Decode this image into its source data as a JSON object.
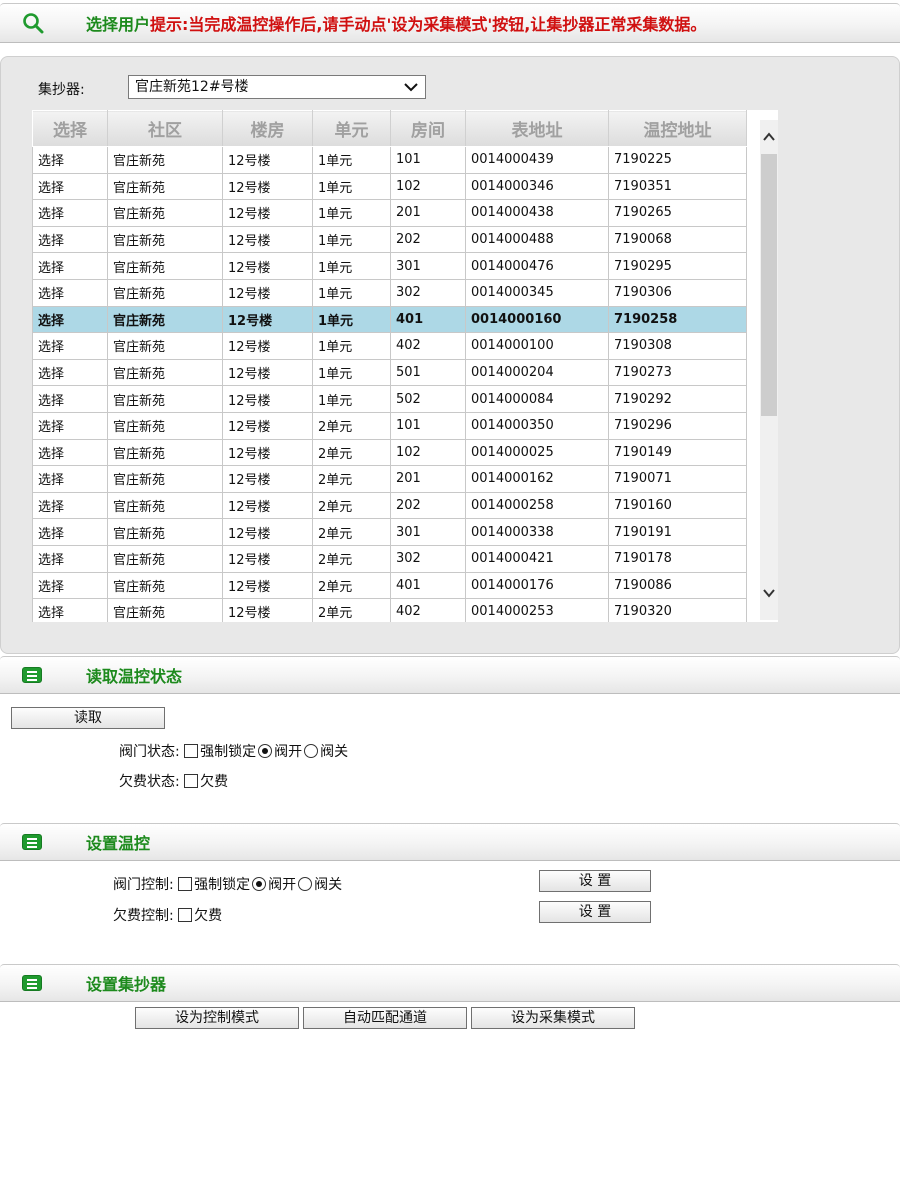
{
  "top_bar": {
    "title": "选择用户",
    "hint": "提示:当完成温控操作后,请手动点'设为采集模式'按钮,让集抄器正常采集数据。"
  },
  "collector": {
    "label": "集抄器:",
    "selected": "官庄新苑12#号楼"
  },
  "table": {
    "columns": [
      "选择",
      "社区",
      "楼房",
      "单元",
      "房间",
      "表地址",
      "温控地址"
    ],
    "selected_index": 6,
    "rows": [
      [
        "选择",
        "官庄新苑",
        "12号楼",
        "1单元",
        "101",
        "0014000439",
        "7190225"
      ],
      [
        "选择",
        "官庄新苑",
        "12号楼",
        "1单元",
        "102",
        "0014000346",
        "7190351"
      ],
      [
        "选择",
        "官庄新苑",
        "12号楼",
        "1单元",
        "201",
        "0014000438",
        "7190265"
      ],
      [
        "选择",
        "官庄新苑",
        "12号楼",
        "1单元",
        "202",
        "0014000488",
        "7190068"
      ],
      [
        "选择",
        "官庄新苑",
        "12号楼",
        "1单元",
        "301",
        "0014000476",
        "7190295"
      ],
      [
        "选择",
        "官庄新苑",
        "12号楼",
        "1单元",
        "302",
        "0014000345",
        "7190306"
      ],
      [
        "选择",
        "官庄新苑",
        "12号楼",
        "1单元",
        "401",
        "0014000160",
        "7190258"
      ],
      [
        "选择",
        "官庄新苑",
        "12号楼",
        "1单元",
        "402",
        "0014000100",
        "7190308"
      ],
      [
        "选择",
        "官庄新苑",
        "12号楼",
        "1单元",
        "501",
        "0014000204",
        "7190273"
      ],
      [
        "选择",
        "官庄新苑",
        "12号楼",
        "1单元",
        "502",
        "0014000084",
        "7190292"
      ],
      [
        "选择",
        "官庄新苑",
        "12号楼",
        "2单元",
        "101",
        "0014000350",
        "7190296"
      ],
      [
        "选择",
        "官庄新苑",
        "12号楼",
        "2单元",
        "102",
        "0014000025",
        "7190149"
      ],
      [
        "选择",
        "官庄新苑",
        "12号楼",
        "2单元",
        "201",
        "0014000162",
        "7190071"
      ],
      [
        "选择",
        "官庄新苑",
        "12号楼",
        "2单元",
        "202",
        "0014000258",
        "7190160"
      ],
      [
        "选择",
        "官庄新苑",
        "12号楼",
        "2单元",
        "301",
        "0014000338",
        "7190191"
      ],
      [
        "选择",
        "官庄新苑",
        "12号楼",
        "2单元",
        "302",
        "0014000421",
        "7190178"
      ],
      [
        "选择",
        "官庄新苑",
        "12号楼",
        "2单元",
        "401",
        "0014000176",
        "7190086"
      ],
      [
        "选择",
        "官庄新苑",
        "12号楼",
        "2单元",
        "402",
        "0014000253",
        "7190320"
      ]
    ]
  },
  "read_section": {
    "title": "读取温控状态",
    "read_button": "读取",
    "valve_label": "阀门状态:",
    "valve_options": [
      "强制锁定",
      "阀开",
      "阀关"
    ],
    "valve_selected": "阀开",
    "arrears_label": "欠费状态:",
    "arrears_option": "欠费"
  },
  "set_section": {
    "title": "设置温控",
    "valve_label": "阀门控制:",
    "valve_options": [
      "强制锁定",
      "阀开",
      "阀关"
    ],
    "valve_selected": "阀开",
    "arrears_label": "欠费控制:",
    "arrears_option": "欠费",
    "set_button": "设 置"
  },
  "collector_section": {
    "title": "设置集抄器",
    "buttons": [
      "设为控制模式",
      "自动匹配通道",
      "设为采集模式"
    ]
  },
  "colors": {
    "title_green": "#1d8a1d",
    "hint_red": "#d01010",
    "selected_row": "#add8e6",
    "icon_green": "#1f9a2e"
  }
}
